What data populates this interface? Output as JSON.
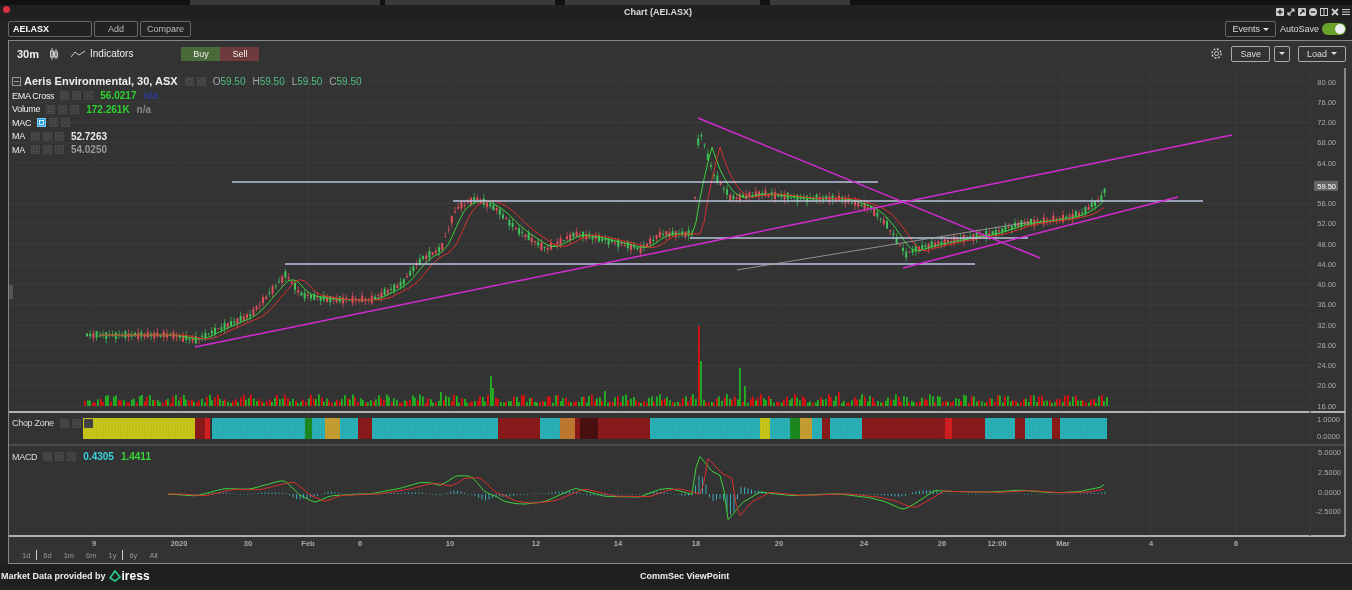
{
  "window": {
    "title": "Chart (AEI.ASX)"
  },
  "toolbar": {
    "symbol": "AEI.ASX",
    "buttons": [
      "Add",
      "Compare"
    ],
    "events": "Events",
    "autosave": {
      "label": "AutoSave",
      "on": true
    }
  },
  "chart_header": {
    "interval": "30m",
    "indicators": "Indicators",
    "buy": "Buy",
    "sell": "Sell",
    "save": "Save",
    "load": "Load"
  },
  "legend": {
    "title": "Aeris Environmental, 30, ASX",
    "ohlc": [
      {
        "key": "O",
        "value": "59.50"
      },
      {
        "key": "H",
        "value": "59.50"
      },
      {
        "key": "L",
        "value": "59.50"
      },
      {
        "key": "C",
        "value": "59.50"
      }
    ]
  },
  "indicators": [
    {
      "name": "EMA Cross",
      "highlighted": false,
      "values": [
        {
          "text": "56.0217",
          "color": "#2fd02f"
        },
        {
          "text": "n/a",
          "color": "#2a3a9a"
        }
      ]
    },
    {
      "name": "Volume",
      "highlighted": false,
      "values": [
        {
          "text": "172.261K",
          "color": "#2fd02f"
        },
        {
          "text": "n/a",
          "color": "#8a8a8a"
        }
      ]
    },
    {
      "name": "MAC",
      "highlighted": true
    },
    {
      "name": "MA",
      "highlighted": false,
      "values": [
        {
          "text": "52.7263",
          "color": "#e8e8e8"
        }
      ]
    },
    {
      "name": "MA",
      "highlighted": false,
      "values": [
        {
          "text": "54.0250",
          "color": "#9a9a9a"
        }
      ]
    }
  ],
  "price_axis": {
    "ticks": [
      "80.00",
      "76.00",
      "72.00",
      "68.00",
      "64.00",
      "56.00",
      "52.00",
      "48.00",
      "44.00",
      "40.00",
      "36.00",
      "32.00",
      "28.00",
      "24.00",
      "20.00",
      "16.00"
    ],
    "last_price": "59.50"
  },
  "chop_zone": {
    "name": "Chop Zone",
    "ticks": [
      "1.0000",
      "0.0000"
    ]
  },
  "macd": {
    "name": "MACD",
    "values": [
      {
        "text": "0.4305",
        "color": "#39d3dc"
      },
      {
        "text": "1.4411",
        "color": "#3ad13a"
      }
    ],
    "ticks": [
      "5.0000",
      "2.5000",
      "0.0000",
      "-2.5000"
    ]
  },
  "time_axis": [
    "9",
    "2020",
    "30",
    "Feb",
    "6",
    "10",
    "12",
    "14",
    "18",
    "20",
    "24",
    "26",
    "12:00",
    "Mar",
    "4",
    "6"
  ],
  "ranges": [
    "1d",
    "6d",
    "1m",
    "6m",
    "1y",
    "6y",
    "All"
  ],
  "footer": {
    "provider": "Market Data provided by",
    "logo": "iress",
    "center": "CommSec ViewPoint"
  }
}
